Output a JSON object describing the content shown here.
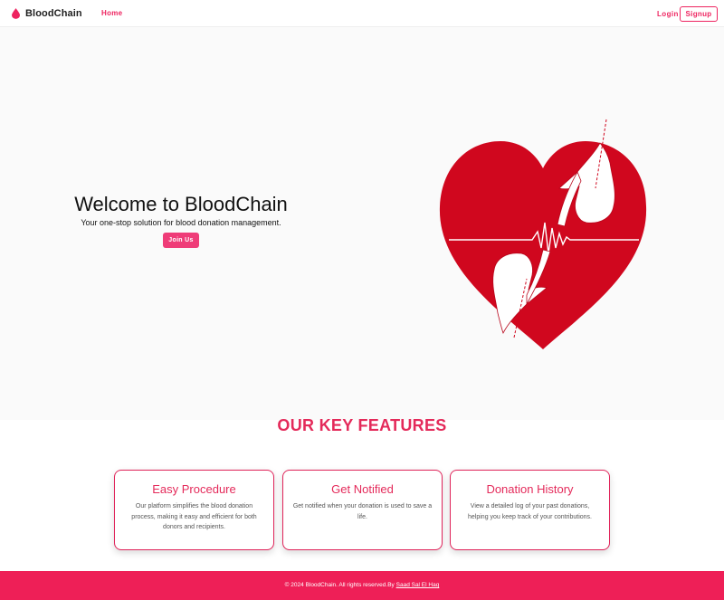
{
  "colors": {
    "accent": "#ee2460",
    "footer": "#ee1f57",
    "heart": "#d0071e"
  },
  "navbar": {
    "brand": "BloodChain",
    "home": "Home",
    "login": "Login",
    "signup": "Signup"
  },
  "hero": {
    "title": "Welcome to BloodChain",
    "subtitle": "Your one-stop solution for blood donation management.",
    "cta": "Join Us"
  },
  "features": {
    "title": "OUR KEY FEATURES",
    "cards": [
      {
        "title": "Easy Procedure",
        "text": "Our platform simplifies the blood donation process, making it easy and efficient for both donors and recipients."
      },
      {
        "title": "Get Notified",
        "text": "Get notified when your donation is used to save a life."
      },
      {
        "title": "Donation History",
        "text": "View a detailed log of your past donations, helping you keep track of your contributions."
      }
    ]
  },
  "footer": {
    "text": "© 2024 BloodChain. All rights reserved.By ",
    "author": "Saad Sal El Haq"
  }
}
